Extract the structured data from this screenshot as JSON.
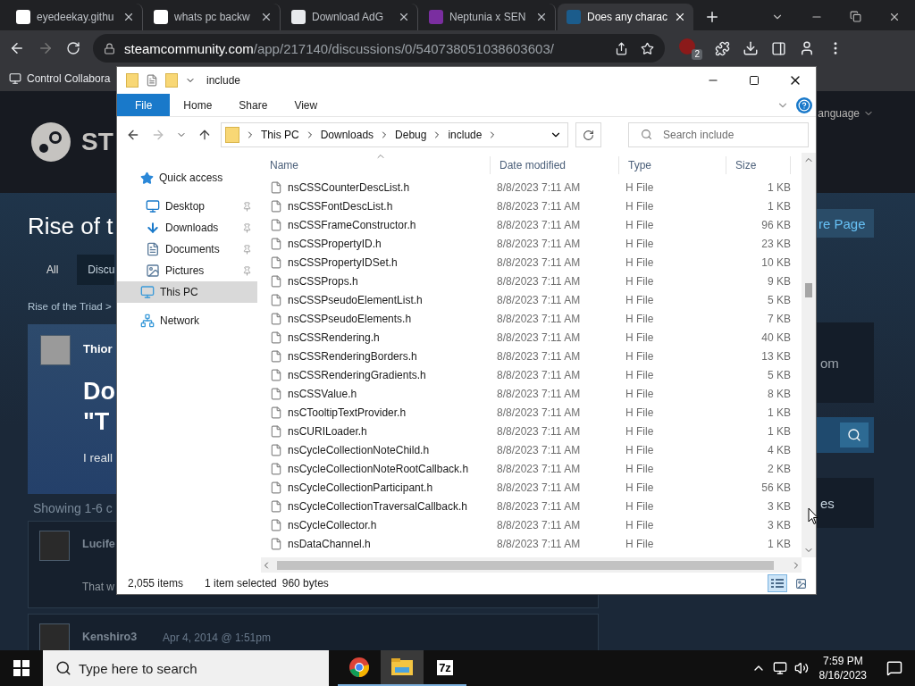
{
  "browser": {
    "tabs": [
      {
        "title": "eyedeekay.githu",
        "selected": false,
        "kind": "ip"
      },
      {
        "title": "whats pc backw",
        "selected": false,
        "kind": "google"
      },
      {
        "title": "Download AdG",
        "selected": false,
        "kind": "adguard"
      },
      {
        "title": "Neptunia x SEN",
        "selected": false,
        "kind": "neptunia"
      },
      {
        "title": "Does any charac",
        "selected": true,
        "kind": "steam"
      }
    ],
    "url_host": "steamcommunity.com",
    "url_path": "/app/217140/discussions/0/540738051038603603/",
    "extension_badge": "2",
    "bookmarks": [
      {
        "label": "Control Collabora"
      }
    ]
  },
  "steam_page": {
    "logo_text": "ST",
    "language": "anguage",
    "game_title": "Rise of t",
    "tabs": [
      {
        "label": "All",
        "selected": false
      },
      {
        "label": "Discu",
        "selected": true
      }
    ],
    "store_button": "re Page",
    "breadcrumb": "Rise of the Triad >",
    "op_author": "Thior",
    "op_title_lines": [
      "Do",
      "\"T"
    ],
    "op_body": "I reall",
    "side_box_text": "om",
    "side_box_2_text": "es",
    "showing": "Showing 1-6 c",
    "replies": [
      {
        "author": "Lucife",
        "body": "That w"
      },
      {
        "author": "Kenshiro3",
        "date": "Apr 4, 2014 @ 1:51pm"
      }
    ]
  },
  "explorer": {
    "title": "include",
    "ribbon_tabs": [
      {
        "label": "File",
        "kind": "file"
      },
      {
        "label": "Home",
        "kind": "tab"
      },
      {
        "label": "Share",
        "kind": "tab"
      },
      {
        "label": "View",
        "kind": "tab"
      }
    ],
    "path": [
      "This PC",
      "Downloads",
      "Debug",
      "include"
    ],
    "search_placeholder": "Search include",
    "nav": [
      {
        "label": "Quick access",
        "kind": "star",
        "selected": false,
        "children": [
          {
            "label": "Desktop",
            "kind": "desktop",
            "pinned": true,
            "selected": false
          },
          {
            "label": "Downloads",
            "kind": "downloads",
            "pinned": true,
            "selected": false
          },
          {
            "label": "Documents",
            "kind": "documents",
            "pinned": true,
            "selected": false
          },
          {
            "label": "Pictures",
            "kind": "pictures",
            "pinned": true,
            "selected": false
          }
        ]
      },
      {
        "label": "This PC",
        "kind": "pc",
        "selected": true
      },
      {
        "label": "Network",
        "kind": "network",
        "selected": false
      }
    ],
    "columns": [
      "Name",
      "Date modified",
      "Type",
      "Size"
    ],
    "rows": [
      {
        "name": "nsCSSCounterDescList.h",
        "date": "8/8/2023 7:11 AM",
        "type": "H File",
        "size": "1 KB"
      },
      {
        "name": "nsCSSFontDescList.h",
        "date": "8/8/2023 7:11 AM",
        "type": "H File",
        "size": "1 KB"
      },
      {
        "name": "nsCSSFrameConstructor.h",
        "date": "8/8/2023 7:11 AM",
        "type": "H File",
        "size": "96 KB"
      },
      {
        "name": "nsCSSPropertyID.h",
        "date": "8/8/2023 7:11 AM",
        "type": "H File",
        "size": "23 KB"
      },
      {
        "name": "nsCSSPropertyIDSet.h",
        "date": "8/8/2023 7:11 AM",
        "type": "H File",
        "size": "10 KB"
      },
      {
        "name": "nsCSSProps.h",
        "date": "8/8/2023 7:11 AM",
        "type": "H File",
        "size": "9 KB"
      },
      {
        "name": "nsCSSPseudoElementList.h",
        "date": "8/8/2023 7:11 AM",
        "type": "H File",
        "size": "5 KB"
      },
      {
        "name": "nsCSSPseudoElements.h",
        "date": "8/8/2023 7:11 AM",
        "type": "H File",
        "size": "7 KB"
      },
      {
        "name": "nsCSSRendering.h",
        "date": "8/8/2023 7:11 AM",
        "type": "H File",
        "size": "40 KB"
      },
      {
        "name": "nsCSSRenderingBorders.h",
        "date": "8/8/2023 7:11 AM",
        "type": "H File",
        "size": "13 KB"
      },
      {
        "name": "nsCSSRenderingGradients.h",
        "date": "8/8/2023 7:11 AM",
        "type": "H File",
        "size": "5 KB"
      },
      {
        "name": "nsCSSValue.h",
        "date": "8/8/2023 7:11 AM",
        "type": "H File",
        "size": "8 KB"
      },
      {
        "name": "nsCTooltipTextProvider.h",
        "date": "8/8/2023 7:11 AM",
        "type": "H File",
        "size": "1 KB"
      },
      {
        "name": "nsCURILoader.h",
        "date": "8/8/2023 7:11 AM",
        "type": "H File",
        "size": "1 KB"
      },
      {
        "name": "nsCycleCollectionNoteChild.h",
        "date": "8/8/2023 7:11 AM",
        "type": "H File",
        "size": "4 KB"
      },
      {
        "name": "nsCycleCollectionNoteRootCallback.h",
        "date": "8/8/2023 7:11 AM",
        "type": "H File",
        "size": "2 KB"
      },
      {
        "name": "nsCycleCollectionParticipant.h",
        "date": "8/8/2023 7:11 AM",
        "type": "H File",
        "size": "56 KB"
      },
      {
        "name": "nsCycleCollectionTraversalCallback.h",
        "date": "8/8/2023 7:11 AM",
        "type": "H File",
        "size": "3 KB"
      },
      {
        "name": "nsCycleCollector.h",
        "date": "8/8/2023 7:11 AM",
        "type": "H File",
        "size": "3 KB"
      },
      {
        "name": "nsDataChannel.h",
        "date": "8/8/2023 7:11 AM",
        "type": "H File",
        "size": "1 KB"
      }
    ],
    "status": {
      "count": "2,055 items",
      "selection": "1 item selected",
      "size": "960 bytes"
    }
  },
  "taskbar": {
    "search_placeholder": "Type here to search",
    "apps": [
      {
        "kind": "chrome",
        "active": false
      },
      {
        "kind": "explorer",
        "active": true
      },
      {
        "kind": "sevenzip",
        "label": "7z",
        "active": false
      }
    ],
    "time": "7:59 PM",
    "date": "8/16/2023"
  }
}
